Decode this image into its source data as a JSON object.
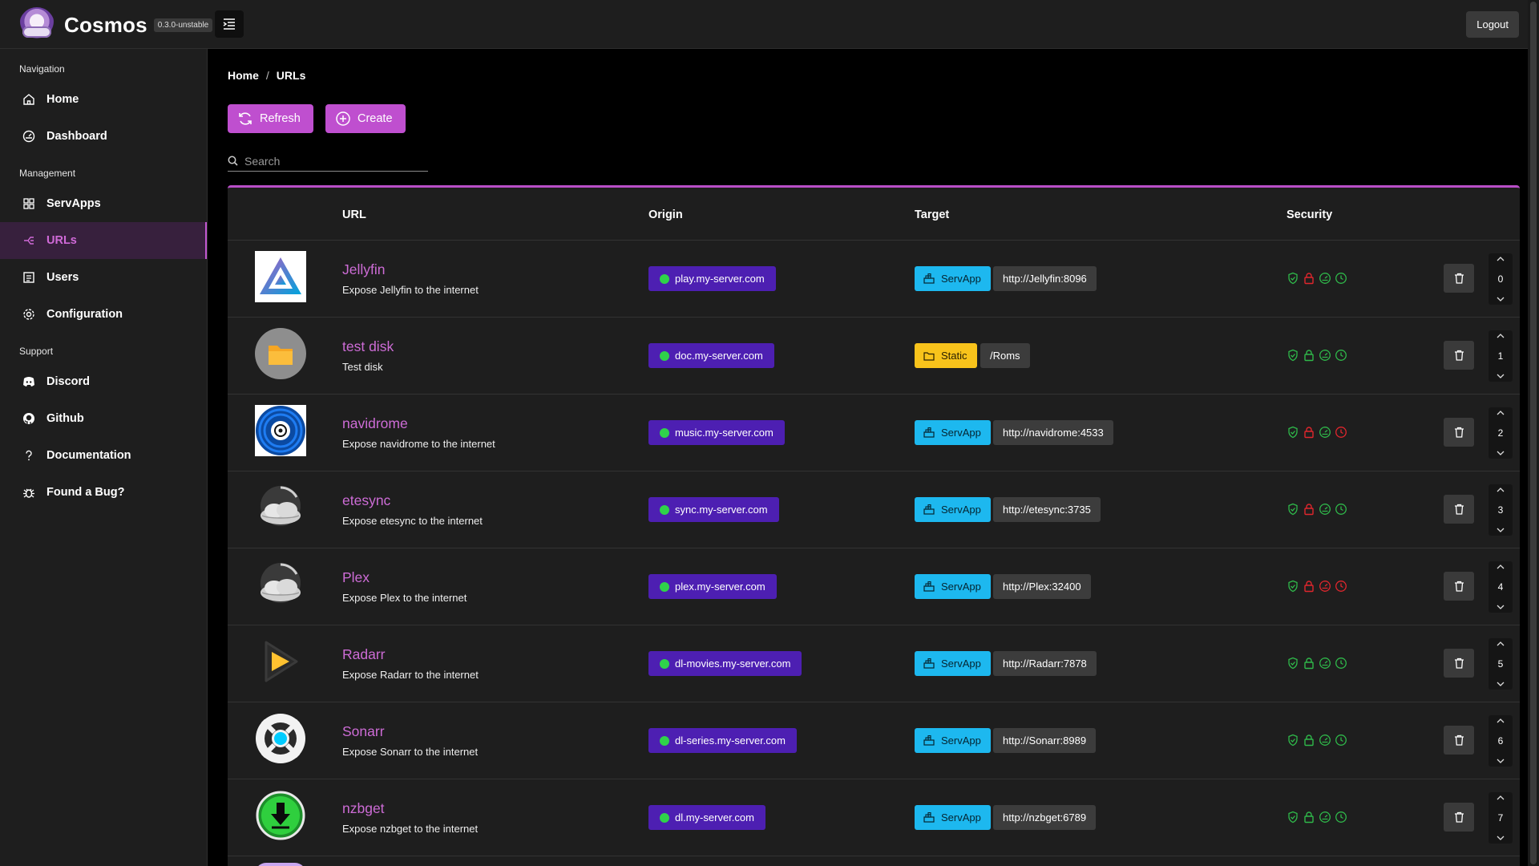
{
  "app": {
    "name": "Cosmos",
    "version": "0.3.0-unstable",
    "logout_label": "Logout"
  },
  "sidebar": {
    "sections": [
      {
        "title": "Navigation",
        "items": [
          {
            "label": "Home",
            "icon": "home-icon"
          },
          {
            "label": "Dashboard",
            "icon": "dashboard-icon"
          }
        ]
      },
      {
        "title": "Management",
        "items": [
          {
            "label": "ServApps",
            "icon": "grid-icon"
          },
          {
            "label": "URLs",
            "icon": "network-icon",
            "active": true
          },
          {
            "label": "Users",
            "icon": "users-list-icon"
          },
          {
            "label": "Configuration",
            "icon": "gear-icon"
          }
        ]
      },
      {
        "title": "Support",
        "items": [
          {
            "label": "Discord",
            "icon": "discord-icon"
          },
          {
            "label": "Github",
            "icon": "github-icon"
          },
          {
            "label": "Documentation",
            "icon": "question-icon"
          },
          {
            "label": "Found a Bug?",
            "icon": "bug-icon"
          }
        ]
      }
    ]
  },
  "breadcrumb": {
    "home": "Home",
    "current": "URLs",
    "separator": "/"
  },
  "toolbar": {
    "refresh_label": "Refresh",
    "create_label": "Create"
  },
  "search": {
    "placeholder": "Search",
    "value": ""
  },
  "table": {
    "headers": {
      "url": "URL",
      "origin": "Origin",
      "target": "Target",
      "security": "Security"
    },
    "rows": [
      {
        "name": "Jellyfin",
        "description": "Expose Jellyfin to the internet",
        "origin": "play.my-server.com",
        "target_type": "ServApp",
        "target": "http://Jellyfin:8096",
        "icon": "jellyfin",
        "security": [
          "green",
          "red",
          "green",
          "green"
        ],
        "order": "0"
      },
      {
        "name": "test disk",
        "description": "Test disk",
        "origin": "doc.my-server.com",
        "target_type": "Static",
        "target": "/Roms",
        "icon": "folder",
        "security": [
          "green",
          "green",
          "green",
          "green"
        ],
        "order": "1"
      },
      {
        "name": "navidrome",
        "description": "Expose navidrome to the internet",
        "origin": "music.my-server.com",
        "target_type": "ServApp",
        "target": "http://navidrome:4533",
        "icon": "navidrome",
        "security": [
          "green",
          "red",
          "green",
          "red"
        ],
        "order": "2"
      },
      {
        "name": "etesync",
        "description": "Expose etesync to the internet",
        "origin": "sync.my-server.com",
        "target_type": "ServApp",
        "target": "http://etesync:3735",
        "icon": "cloud",
        "security": [
          "green",
          "red",
          "green",
          "green"
        ],
        "order": "3"
      },
      {
        "name": "Plex",
        "description": "Expose Plex to the internet",
        "origin": "plex.my-server.com",
        "target_type": "ServApp",
        "target": "http://Plex:32400",
        "icon": "cloud",
        "security": [
          "green",
          "red",
          "red",
          "red"
        ],
        "order": "4"
      },
      {
        "name": "Radarr",
        "description": "Expose Radarr to the internet",
        "origin": "dl-movies.my-server.com",
        "target_type": "ServApp",
        "target": "http://Radarr:7878",
        "icon": "radarr",
        "security": [
          "green",
          "green",
          "green",
          "green"
        ],
        "order": "5"
      },
      {
        "name": "Sonarr",
        "description": "Expose Sonarr to the internet",
        "origin": "dl-series.my-server.com",
        "target_type": "ServApp",
        "target": "http://Sonarr:8989",
        "icon": "sonarr",
        "security": [
          "green",
          "green",
          "green",
          "green"
        ],
        "order": "6"
      },
      {
        "name": "nzbget",
        "description": "Expose nzbget to the internet",
        "origin": "dl.my-server.com",
        "target_type": "ServApp",
        "target": "http://nzbget:6789",
        "icon": "nzbget",
        "security": [
          "green",
          "green",
          "green",
          "green"
        ],
        "order": "7"
      }
    ]
  },
  "colors": {
    "accent": "#bf4fcf",
    "origin_bg": "#4d1fb2",
    "servapp": "#1db8ef",
    "static": "#f8c31b",
    "green": "#2fb84a",
    "red": "#e0262d"
  }
}
